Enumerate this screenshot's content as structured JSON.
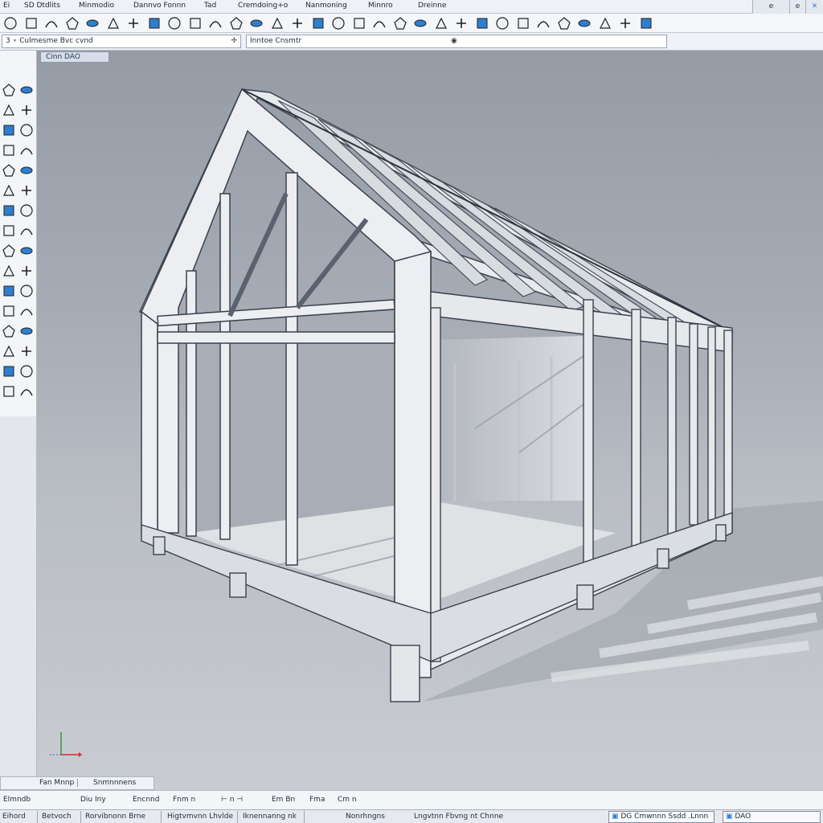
{
  "menu": {
    "items": [
      "Ei",
      "SD Dtdlits",
      "Minmodio",
      "Dannvo Fonnn",
      "Tad",
      "Cremdoing+o",
      "Nanmoning",
      "Minnro",
      "Dreinne"
    ]
  },
  "window_controls": {
    "minimize": "e",
    "restore": "e",
    "close": "✕"
  },
  "options_bar": {
    "left_field": "3 ∘ Culmesme  Bvc cvnd",
    "right_field": "Inntoe  Cnsmtr"
  },
  "viewport": {
    "label": "Cinn DAO",
    "axis": {
      "x": "x",
      "y": "y"
    }
  },
  "layout_tabs": {
    "model": "Fan Mnnp",
    "layout": "Snmnnnens"
  },
  "command_line": {
    "items": [
      "Elmndb",
      "Diu  Iny",
      "Encnnd",
      "Fnm  n",
      "⊢ n ⊣",
      "Em  Bn",
      "Fma",
      "Cm  n"
    ]
  },
  "status_bar": {
    "items": [
      "Eihord",
      "Betvoch",
      "Rorvibnonn Brne",
      "Higtvmvnn Lhvlde",
      "Iknennanng nk",
      "Nonrhngns",
      "Lngvtnn Fbvng nt Chnne"
    ],
    "coords_box": "DG  Cmwnnn Ssdd .Lnnn",
    "mode_box": "DAO"
  },
  "colors": {
    "accent": "#2d7fcf",
    "icon_yellow": "#e0a52a",
    "chrome": "#eef1f5",
    "viewport_top": "#969ca6",
    "viewport_bottom": "#c9ccd1"
  },
  "toolbar_icons": [
    "sphere-icon",
    "cube-icon",
    "arc-icon",
    "polygon-icon",
    "pipe-icon",
    "cylinder-icon",
    "extrude-icon",
    "lock-icon",
    "cone-icon",
    "dimension-icon",
    "rotate-icon",
    "scale-icon",
    "copy-icon",
    "move-icon",
    "measure-icon",
    "section-icon",
    "align-icon",
    "trim-icon",
    "hatch-icon",
    "pencil-icon",
    "scissors-icon",
    "link-icon",
    "layer-icon",
    "camera-icon",
    "render-icon",
    "sun-icon",
    "cloud-icon",
    "text-icon",
    "image-icon",
    "save-icon",
    "print-icon",
    "monitor-icon"
  ],
  "palette_icons": [
    "select-icon",
    "pan-icon",
    "line-icon",
    "polyline-icon",
    "arc-tool-icon",
    "circle-tool-icon",
    "rectangle-icon",
    "spline-icon",
    "offset-icon",
    "fillet-icon",
    "mirror-icon",
    "array-icon",
    "extend-icon",
    "stretch-icon",
    "chamfer-icon",
    "join-icon",
    "explode-icon",
    "block-icon",
    "wall-icon",
    "door-icon",
    "window-icon",
    "roof-icon",
    "stair-icon",
    "beam-icon",
    "column-icon",
    "slab-icon",
    "grid-icon",
    "level-icon",
    "material-icon",
    "light-icon",
    "view-icon",
    "walk-icon"
  ]
}
